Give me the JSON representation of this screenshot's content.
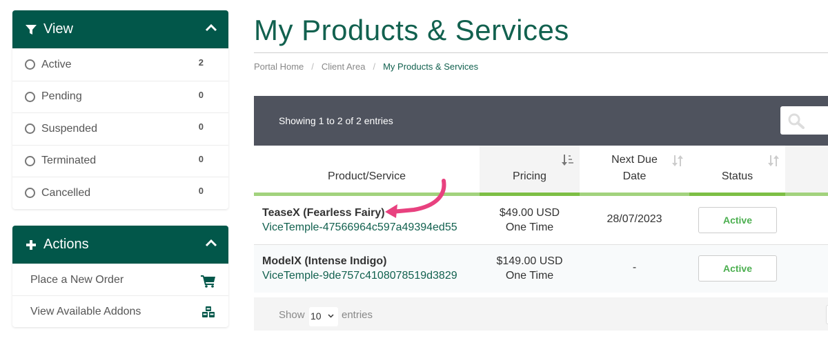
{
  "sidebar": {
    "view": {
      "title": "View",
      "icon": "filter-icon",
      "items": [
        {
          "label": "Active",
          "count": "2"
        },
        {
          "label": "Pending",
          "count": "0"
        },
        {
          "label": "Suspended",
          "count": "0"
        },
        {
          "label": "Terminated",
          "count": "0"
        },
        {
          "label": "Cancelled",
          "count": "0"
        }
      ]
    },
    "actions": {
      "title": "Actions",
      "icon": "plus-icon",
      "items": [
        {
          "label": "Place a New Order",
          "icon": "shopping-cart-icon"
        },
        {
          "label": "View Available Addons",
          "icon": "cubes-icon"
        }
      ]
    }
  },
  "page": {
    "title": "My Products & Services",
    "breadcrumb": [
      "Portal Home",
      "Client Area",
      "My Products & Services"
    ],
    "breadcrumb_separator": "/"
  },
  "table": {
    "info": "Showing 1 to 2 of 2 entries",
    "search_icon": "search-icon",
    "columns": [
      {
        "label": "Product/Service"
      },
      {
        "label": "Pricing",
        "sorted": true
      },
      {
        "label": "Next Due Date",
        "line1": "Next Due",
        "line2": "Date"
      },
      {
        "label": "Status"
      }
    ],
    "rows": [
      {
        "product": "TeaseX (Fearless Fairy)",
        "domain": "ViceTemple-47566964c597a49394ed55",
        "price": "$49.00 USD",
        "cycle": "One Time",
        "next_due": "28/07/2023",
        "status": "Active"
      },
      {
        "product": "ModelX (Intense Indigo)",
        "domain": "ViceTemple-9de757c4108078519d3829",
        "price": "$149.00 USD",
        "cycle": "One Time",
        "next_due": "-",
        "status": "Active"
      }
    ],
    "footer": {
      "show_label": "Show",
      "page_length": "10",
      "entries_label": "entries"
    }
  },
  "colors": {
    "brand_green": "#02574a",
    "title_green": "#12614f",
    "status_green": "#4caf50",
    "table_header_dark": "#4f535e",
    "annotation_pink": "#e8417f"
  }
}
